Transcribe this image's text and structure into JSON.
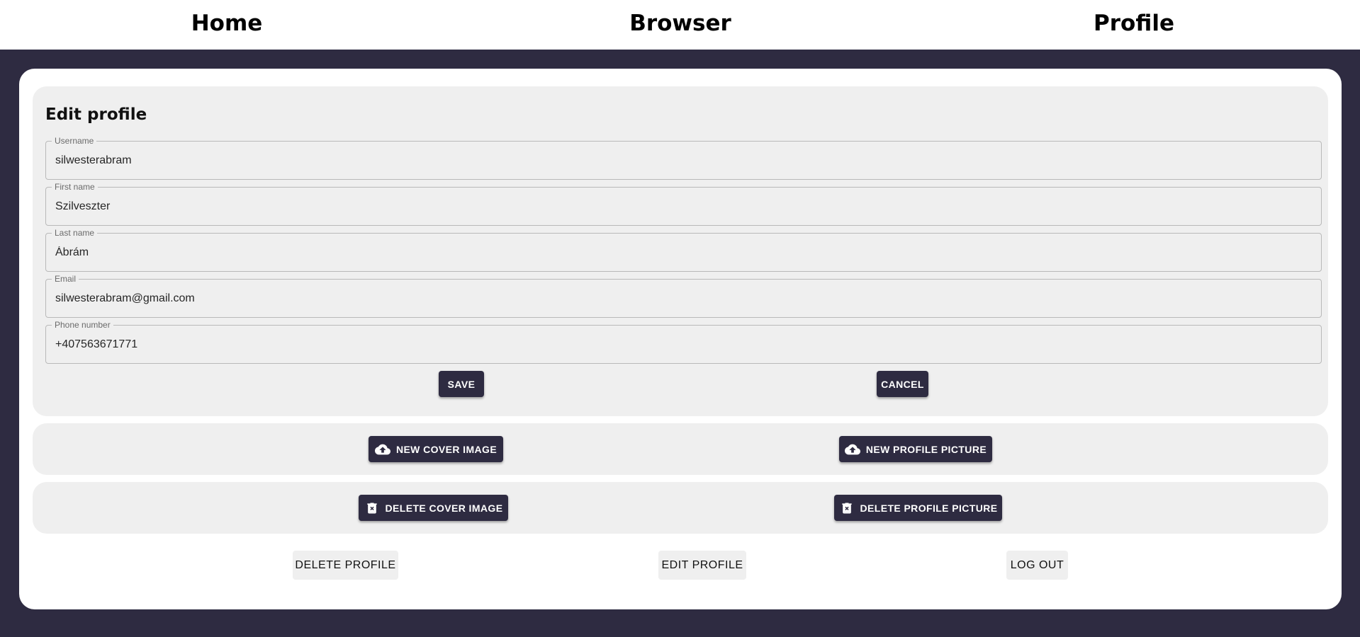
{
  "nav": {
    "home": "Home",
    "browser": "Browser",
    "profile": "Profile"
  },
  "form": {
    "title": "Edit profile",
    "fields": {
      "username": {
        "label": "Username",
        "value": "silwesterabram"
      },
      "first_name": {
        "label": "First name",
        "value": "Szilveszter"
      },
      "last_name": {
        "label": "Last name",
        "value": "Ábrám"
      },
      "email": {
        "label": "Email",
        "value": "silwesterabram@gmail.com"
      },
      "phone": {
        "label": "Phone number",
        "value": "+407563671771"
      }
    },
    "save_label": "SAVE",
    "cancel_label": "CANCEL"
  },
  "images": {
    "new_cover_label": "NEW COVER IMAGE",
    "new_profile_label": "NEW PROFILE PICTURE",
    "delete_cover_label": "DELETE COVER IMAGE",
    "delete_profile_label": "DELETE PROFILE PICTURE",
    "upload_icon": "cloud-upload-icon",
    "delete_icon": "delete-icon"
  },
  "account": {
    "delete_profile_label": "DELETE PROFILE",
    "edit_profile_label": "EDIT PROFILE",
    "logout_label": "LOG OUT"
  },
  "colors": {
    "background": "#2e2b41",
    "panel": "#efefef",
    "button_dark": "#2e2b41",
    "button_text": "#ffffff"
  }
}
